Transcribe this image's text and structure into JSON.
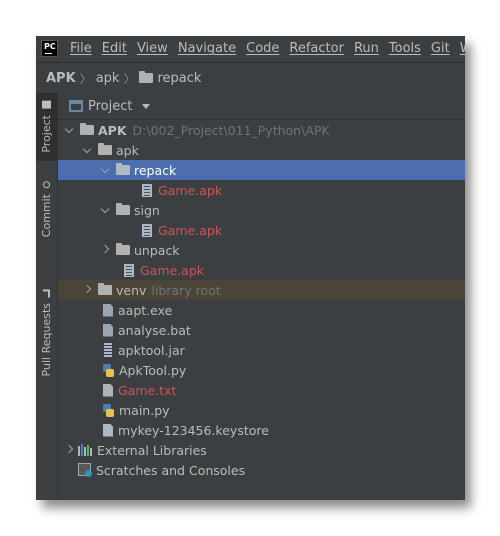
{
  "menubar": {
    "logo_text": "PC",
    "items": [
      {
        "label": "File"
      },
      {
        "label": "Edit"
      },
      {
        "label": "View"
      },
      {
        "label": "Navigate"
      },
      {
        "label": "Code"
      },
      {
        "label": "Refactor"
      },
      {
        "label": "Run"
      },
      {
        "label": "Tools"
      },
      {
        "label": "Git"
      },
      {
        "label": "W"
      }
    ]
  },
  "breadcrumb": [
    "APK",
    "apk",
    "repack"
  ],
  "side_tabs": {
    "project": "Project",
    "commit": "Commit",
    "pull_requests": "Pull Requests"
  },
  "panel": {
    "title": "Project"
  },
  "tree": [
    {
      "label": "APK",
      "path": "D:\\002_Project\\011_Python\\APK"
    },
    {
      "label": "apk"
    },
    {
      "label": "repack"
    },
    {
      "label": "Game.apk"
    },
    {
      "label": "sign"
    },
    {
      "label": "Game.apk"
    },
    {
      "label": "unpack"
    },
    {
      "label": "Game.apk"
    },
    {
      "label": "venv",
      "note": "library root"
    },
    {
      "label": "aapt.exe"
    },
    {
      "label": "analyse.bat"
    },
    {
      "label": "apktool.jar"
    },
    {
      "label": "ApkTool.py"
    },
    {
      "label": "Game.txt"
    },
    {
      "label": "main.py"
    },
    {
      "label": "mykey-123456.keystore"
    },
    {
      "label": "External Libraries"
    },
    {
      "label": "Scratches and Consoles"
    }
  ],
  "colors": {
    "background": "#3c3f41",
    "selection": "#4b6eaf",
    "unversioned_file": "#d25252",
    "text": "#bbbbbb"
  }
}
